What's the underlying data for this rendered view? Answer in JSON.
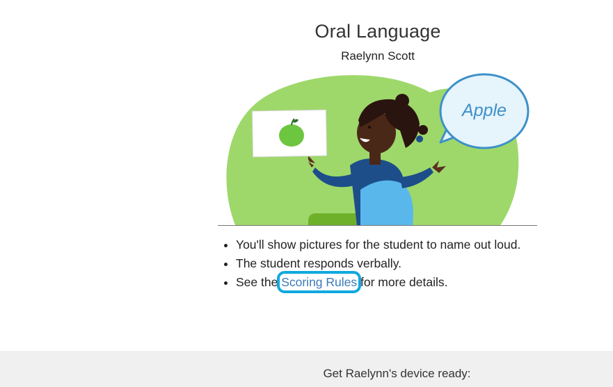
{
  "header": {
    "title": "Oral Language",
    "student_name": "Raelynn Scott"
  },
  "illustration": {
    "speech_word": "Apple",
    "card_icon": "apple-icon",
    "colors": {
      "blob": "#9ed86a",
      "bubble_fill": "#e6f4fb",
      "bubble_stroke": "#3d90c8",
      "apple": "#6cc63f"
    }
  },
  "instructions": {
    "items": [
      {
        "text": "You'll show pictures for the student to name out loud."
      },
      {
        "text": "The student responds verbally."
      }
    ],
    "scoring_prefix": "See the ",
    "scoring_link": "Scoring Rules",
    "scoring_suffix": " for more details."
  },
  "footer": {
    "device_ready": "Get Raelynn's device ready:"
  }
}
